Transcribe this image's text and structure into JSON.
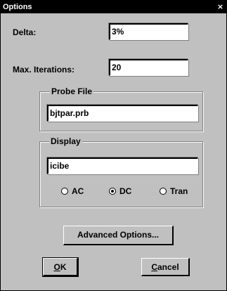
{
  "window": {
    "title": "Options",
    "close_glyph": "×"
  },
  "fields": {
    "delta_label": "Delta:",
    "delta_value": "3%",
    "iterations_label": "Max. Iterations:",
    "iterations_value": "20"
  },
  "probe": {
    "group_title": "Probe File",
    "value": "bjtpar.prb"
  },
  "display": {
    "group_title": "Display",
    "value": "icibe",
    "options": [
      {
        "label": "AC",
        "selected": false
      },
      {
        "label": "DC",
        "selected": true
      },
      {
        "label": "Tran",
        "selected": false
      }
    ]
  },
  "buttons": {
    "advanced": "Advanced Options...",
    "ok_mnemonic": "O",
    "ok_rest": "K",
    "cancel_mnemonic": "C",
    "cancel_rest": "ancel"
  },
  "colors": {
    "dialog_face": "#c0c0c0",
    "titlebar": "#000000"
  }
}
